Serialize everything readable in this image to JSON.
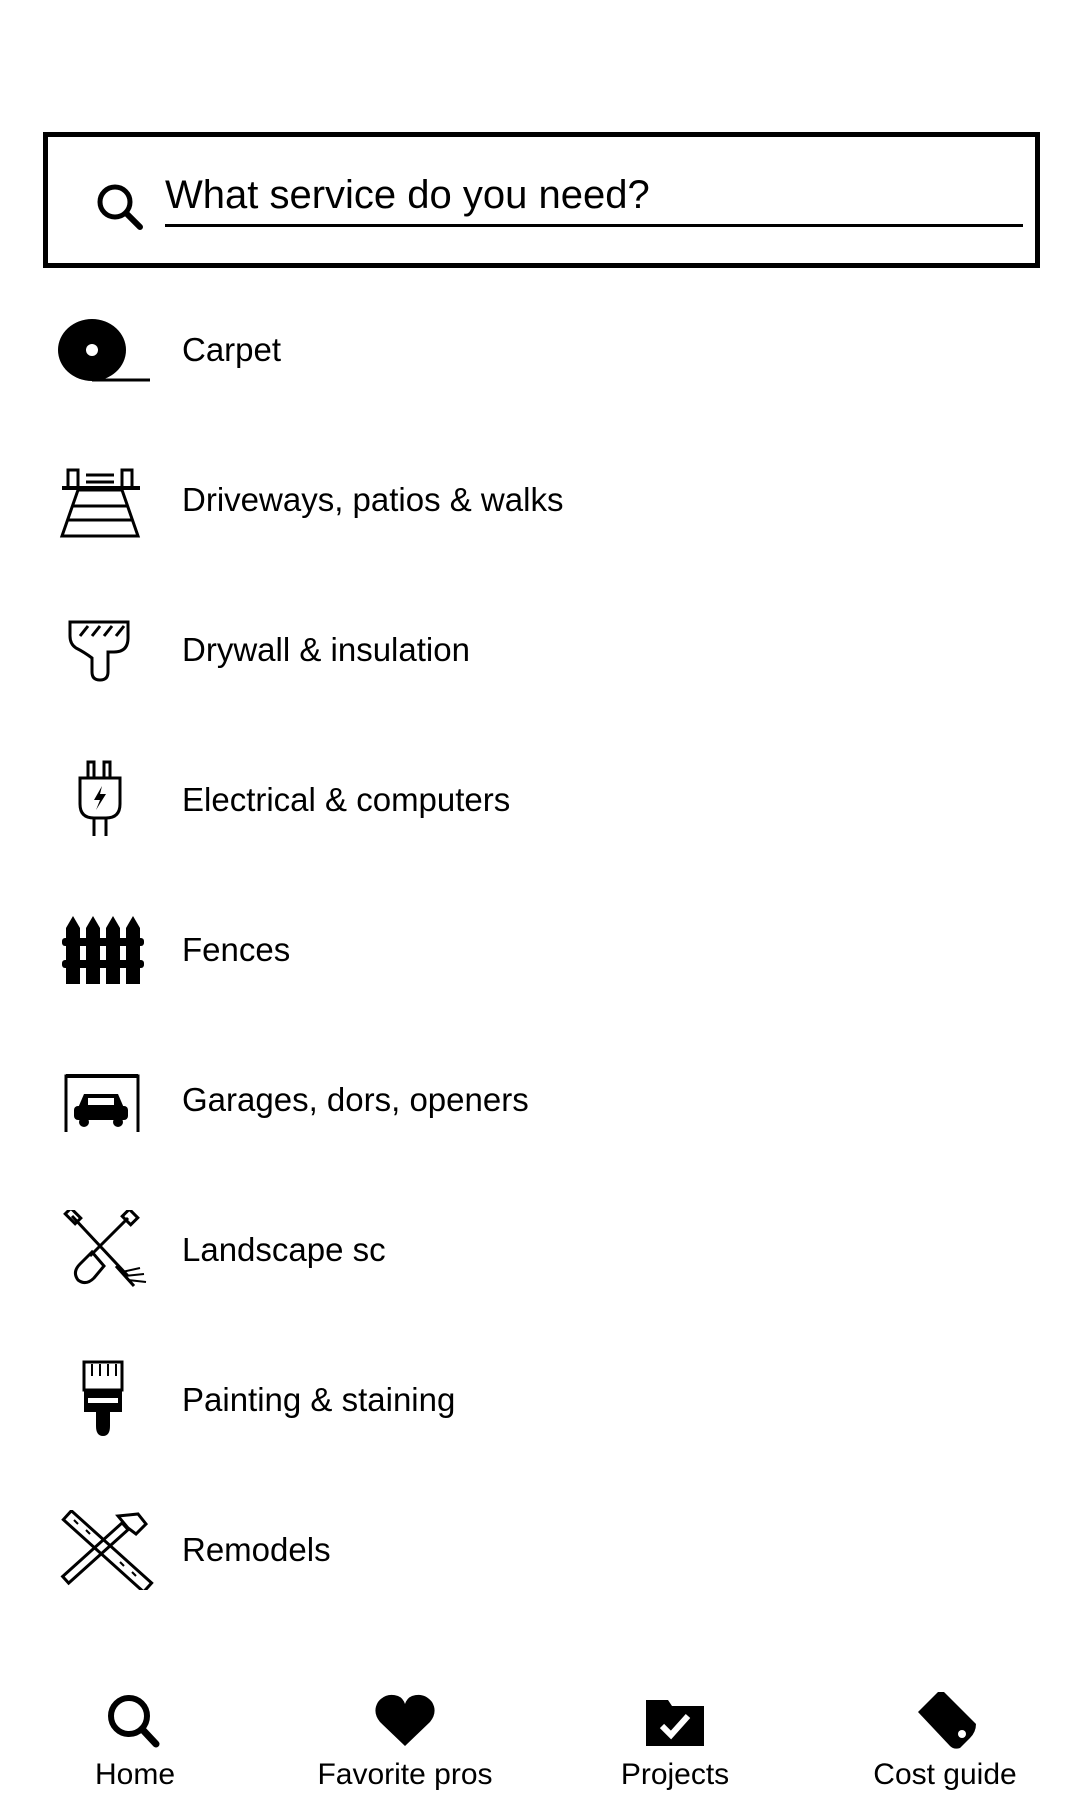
{
  "search": {
    "placeholder": "What service do you need?",
    "value": ""
  },
  "services": [
    {
      "label": "Carpet",
      "icon": "carpet-roll-icon"
    },
    {
      "label": "Driveways, patios & walks",
      "icon": "driveway-icon"
    },
    {
      "label": "Drywall & insulation",
      "icon": "drywall-icon"
    },
    {
      "label": "Electrical & computers",
      "icon": "plug-icon"
    },
    {
      "label": "Fences",
      "icon": "fence-icon"
    },
    {
      "label": "Garages, dors, openers",
      "icon": "garage-icon"
    },
    {
      "label": "Landscape sc",
      "icon": "shovel-rake-icon"
    },
    {
      "label": "Painting & staining",
      "icon": "paintbrush-icon"
    },
    {
      "label": "Remodels",
      "icon": "hammer-ruler-icon"
    }
  ],
  "tabs": [
    {
      "label": "Home",
      "icon": "search-icon"
    },
    {
      "label": "Favorite pros",
      "icon": "heart-icon"
    },
    {
      "label": "Projects",
      "icon": "folder-check-icon"
    },
    {
      "label": "Cost guide",
      "icon": "price-tag-icon"
    }
  ]
}
